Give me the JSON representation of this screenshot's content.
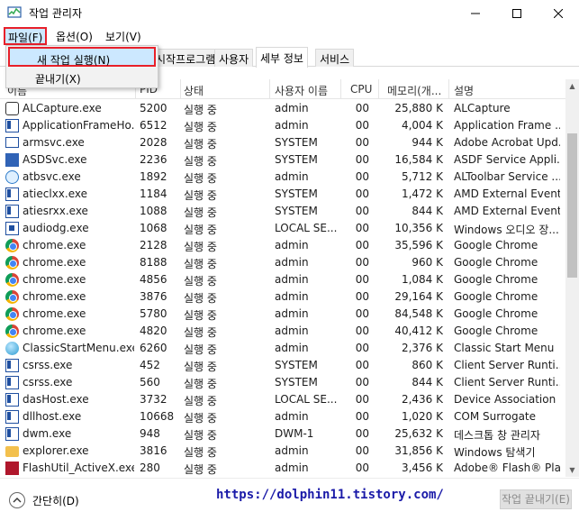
{
  "window": {
    "title": "작업 관리자",
    "icon": "task-manager-icon",
    "controls": [
      "minimize-icon",
      "maximize-icon",
      "close-icon"
    ]
  },
  "menubar": {
    "file": "파일(F)",
    "options": "옵션(O)",
    "view": "보기(V)"
  },
  "dropdown": {
    "new_task": "새 작업 실행(N)",
    "exit": "끝내기(X)"
  },
  "tabs": [
    {
      "label": "시작프로그램"
    },
    {
      "label": "사용자"
    },
    {
      "label": "세부 정보",
      "active": true
    },
    {
      "label": "서비스"
    }
  ],
  "columns": {
    "name": "이름",
    "pid": "PID",
    "status": "상태",
    "user": "사용자 이름",
    "cpu": "CPU",
    "memory": "메모리(개...",
    "desc": "설명"
  },
  "rows": [
    {
      "icon": "alcapture-icon",
      "name": "ALCapture.exe",
      "pid": "5200",
      "status": "실행 중",
      "user": "admin",
      "cpu": "00",
      "mem": "25,880 K",
      "desc": "ALCapture"
    },
    {
      "icon": "app-frame-icon",
      "name": "ApplicationFrameHo...",
      "pid": "6512",
      "status": "실행 중",
      "user": "admin",
      "cpu": "00",
      "mem": "4,004 K",
      "desc": "Application Frame ..."
    },
    {
      "icon": "monitor-icon",
      "name": "armsvc.exe",
      "pid": "2028",
      "status": "실행 중",
      "user": "SYSTEM",
      "cpu": "00",
      "mem": "944 K",
      "desc": "Adobe Acrobat Upd..."
    },
    {
      "icon": "asds-icon",
      "name": "ASDSvc.exe",
      "pid": "2236",
      "status": "실행 중",
      "user": "SYSTEM",
      "cpu": "00",
      "mem": "16,584 K",
      "desc": "ASDF Service Appli..."
    },
    {
      "icon": "globe-icon",
      "name": "atbsvc.exe",
      "pid": "1892",
      "status": "실행 중",
      "user": "admin",
      "cpu": "00",
      "mem": "5,712 K",
      "desc": "ALToolbar Service ..."
    },
    {
      "icon": "app-frame-icon",
      "name": "atieclxx.exe",
      "pid": "1184",
      "status": "실행 중",
      "user": "SYSTEM",
      "cpu": "00",
      "mem": "1,472 K",
      "desc": "AMD External Event..."
    },
    {
      "icon": "app-frame-icon",
      "name": "atiesrxx.exe",
      "pid": "1088",
      "status": "실행 중",
      "user": "SYSTEM",
      "cpu": "00",
      "mem": "844 K",
      "desc": "AMD External Event..."
    },
    {
      "icon": "audio-icon",
      "name": "audiodg.exe",
      "pid": "1068",
      "status": "실행 중",
      "user": "LOCAL SE...",
      "cpu": "00",
      "mem": "10,356 K",
      "desc": "Windows 오디오 장..."
    },
    {
      "icon": "chrome-icon",
      "name": "chrome.exe",
      "pid": "2128",
      "status": "실행 중",
      "user": "admin",
      "cpu": "00",
      "mem": "35,596 K",
      "desc": "Google Chrome"
    },
    {
      "icon": "chrome-icon",
      "name": "chrome.exe",
      "pid": "8188",
      "status": "실행 중",
      "user": "admin",
      "cpu": "00",
      "mem": "960 K",
      "desc": "Google Chrome"
    },
    {
      "icon": "chrome-icon",
      "name": "chrome.exe",
      "pid": "4856",
      "status": "실행 중",
      "user": "admin",
      "cpu": "00",
      "mem": "1,084 K",
      "desc": "Google Chrome"
    },
    {
      "icon": "chrome-icon",
      "name": "chrome.exe",
      "pid": "3876",
      "status": "실행 중",
      "user": "admin",
      "cpu": "00",
      "mem": "29,164 K",
      "desc": "Google Chrome"
    },
    {
      "icon": "chrome-icon",
      "name": "chrome.exe",
      "pid": "5780",
      "status": "실행 중",
      "user": "admin",
      "cpu": "00",
      "mem": "84,548 K",
      "desc": "Google Chrome"
    },
    {
      "icon": "chrome-icon",
      "name": "chrome.exe",
      "pid": "4820",
      "status": "실행 중",
      "user": "admin",
      "cpu": "00",
      "mem": "40,412 K",
      "desc": "Google Chrome"
    },
    {
      "icon": "shell-icon",
      "name": "ClassicStartMenu.exe",
      "pid": "6260",
      "status": "실행 중",
      "user": "admin",
      "cpu": "00",
      "mem": "2,376 K",
      "desc": "Classic Start Menu"
    },
    {
      "icon": "app-frame-icon",
      "name": "csrss.exe",
      "pid": "452",
      "status": "실행 중",
      "user": "SYSTEM",
      "cpu": "00",
      "mem": "860 K",
      "desc": "Client Server Runti..."
    },
    {
      "icon": "app-frame-icon",
      "name": "csrss.exe",
      "pid": "560",
      "status": "실행 중",
      "user": "SYSTEM",
      "cpu": "00",
      "mem": "844 K",
      "desc": "Client Server Runti..."
    },
    {
      "icon": "app-frame-icon",
      "name": "dasHost.exe",
      "pid": "3732",
      "status": "실행 중",
      "user": "LOCAL SE...",
      "cpu": "00",
      "mem": "2,436 K",
      "desc": "Device Association ..."
    },
    {
      "icon": "app-frame-icon",
      "name": "dllhost.exe",
      "pid": "10668",
      "status": "실행 중",
      "user": "admin",
      "cpu": "00",
      "mem": "1,020 K",
      "desc": "COM Surrogate"
    },
    {
      "icon": "app-frame-icon",
      "name": "dwm.exe",
      "pid": "948",
      "status": "실행 중",
      "user": "DWM-1",
      "cpu": "00",
      "mem": "25,632 K",
      "desc": "데스크톱 창 관리자"
    },
    {
      "icon": "folder-icon",
      "name": "explorer.exe",
      "pid": "3816",
      "status": "실행 중",
      "user": "admin",
      "cpu": "00",
      "mem": "31,856 K",
      "desc": "Windows 탐색기"
    },
    {
      "icon": "flash-icon",
      "name": "FlashUtil_ActiveX.exe",
      "pid": "280",
      "status": "실행 중",
      "user": "admin",
      "cpu": "00",
      "mem": "3,456 K",
      "desc": "Adobe® Flash® Pla..."
    }
  ],
  "footer": {
    "collapse": "간단히(D)",
    "watermark": "https://dolphin11.tistory.com/",
    "end_task": "작업 끝내기(E)"
  }
}
